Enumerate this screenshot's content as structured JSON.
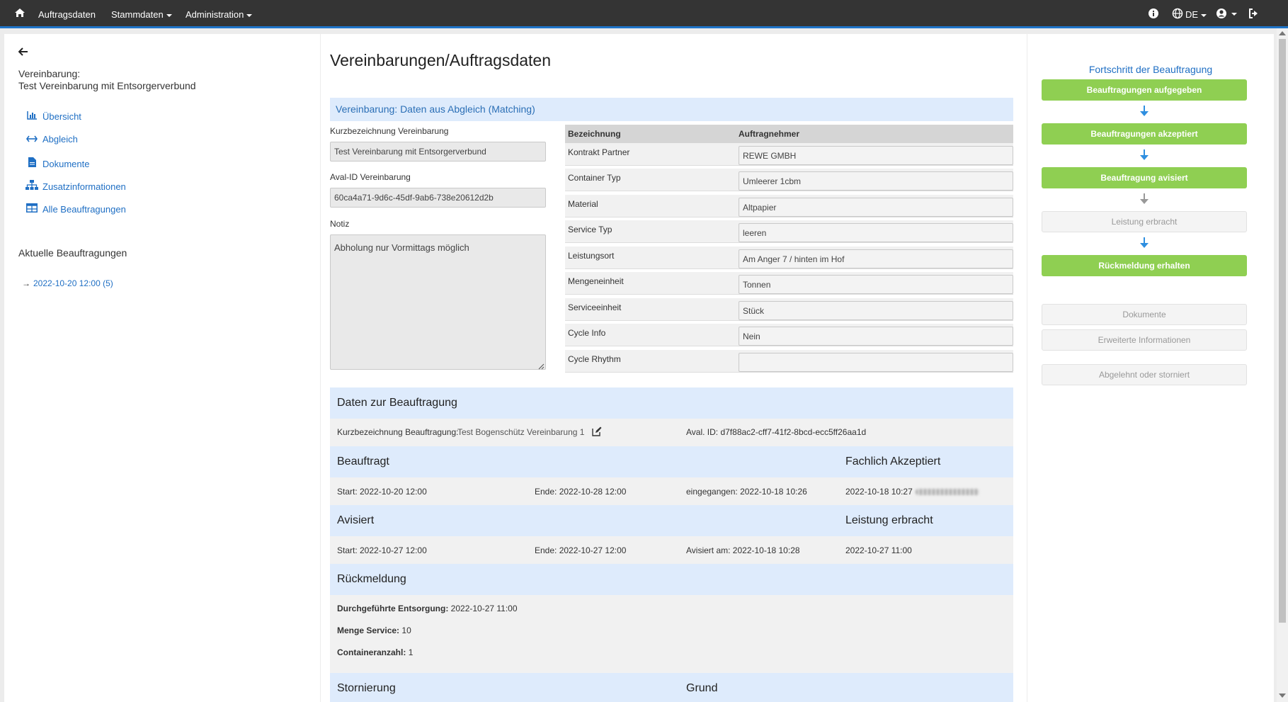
{
  "topbar": {
    "home_icon": "home-icon",
    "nav": [
      "Auftragsdaten",
      "Stammdaten",
      "Administration"
    ],
    "lang": "DE",
    "icons": [
      "info-icon",
      "globe-icon",
      "user-icon",
      "logout-icon"
    ]
  },
  "sidebar": {
    "back_icon": "arrow-left-icon",
    "title_line1": "Vereinbarung:",
    "title_line2": "Test Vereinbarung mit Entsorgerverbund",
    "items": [
      {
        "label": "Übersicht",
        "icon": "chart-icon"
      },
      {
        "label": "Abgleich",
        "icon": "arrows-horizontal-icon"
      },
      {
        "label": "Dokumente",
        "icon": "file-icon"
      },
      {
        "label": "Zusatzinformationen",
        "icon": "sitemap-icon"
      },
      {
        "label": "Alle Beauftragungen",
        "icon": "table-icon"
      }
    ],
    "current_heading": "Aktuelle Beauftragungen",
    "current_item": "2022-10-20 12:00 (5)"
  },
  "main": {
    "title": "Vereinbarungen/Auftragsdaten",
    "matching_band": "Vereinbarung: Daten aus Abgleich (Matching)",
    "kurz_label": "Kurzbezeichnung Vereinbarung",
    "kurz_value": "Test Vereinbarung mit Entsorgerverbund",
    "aval_label": "Aval-ID Vereinbarung",
    "aval_value": "60ca4a71-9d6c-45df-9ab6-738e20612d2b",
    "notiz_label": "Notiz",
    "notiz_value": "Abholung nur Vormittags möglich",
    "table_head": [
      "Bezeichnung",
      "Auftragnehmer"
    ],
    "table_rows": [
      {
        "label": "Kontrakt Partner",
        "value": "REWE GMBH"
      },
      {
        "label": "Container Typ",
        "value": "Umleerer 1cbm"
      },
      {
        "label": "Material",
        "value": "Altpapier"
      },
      {
        "label": "Service Typ",
        "value": "leeren"
      },
      {
        "label": "Leistungsort",
        "value": "Am Anger 7 / hinten im Hof"
      },
      {
        "label": "Mengeneinheit",
        "value": "Tonnen"
      },
      {
        "label": "Serviceeinheit",
        "value": "Stück"
      },
      {
        "label": "Cycle Info",
        "value": "Nein"
      },
      {
        "label": "Cycle Rhythm",
        "value": ""
      }
    ],
    "daten_title": "Daten zur Beauftragung",
    "kurz_b_label": "Kurzbezeichnung Beauftragung:",
    "kurz_b_value": "Test Bogenschütz Vereinbarung 1",
    "edit_icon": "edit-icon",
    "aval_id": "Aval. ID: d7f88ac2-cff7-41f2-8bcd-ecc5ff26aa1d",
    "beauftragt_title": "Beauftragt",
    "fachlich_title": "Fachlich Akzeptiert",
    "b_start": "Start: 2022-10-20 12:00",
    "b_ende": "Ende: 2022-10-28 12:00",
    "b_eingegangen": "eingegangen: 2022-10-18 10:26",
    "b_fachlich": "2022-10-18 10:27",
    "avisiert_title": "Avisiert",
    "leistung_title": "Leistung erbracht",
    "a_start": "Start: 2022-10-27 12:00",
    "a_ende": "Ende: 2022-10-27 12:00",
    "a_avisiert": "Avisiert am: 2022-10-18 10:28",
    "a_leistung": "2022-10-27 11:00",
    "rueck_title": "Rückmeldung",
    "rueck_rows": [
      {
        "label": "Durchgeführte Entsorgung:",
        "value": "2022-10-27 11:00"
      },
      {
        "label": "Menge Service:",
        "value": "10"
      },
      {
        "label": "Containeranzahl:",
        "value": "1"
      }
    ],
    "storno_title": "Stornierung",
    "grund_title": "Grund"
  },
  "progress": {
    "title": "Fortschritt der Beauftragung",
    "steps": [
      {
        "label": "Beauftragungen aufgegeben",
        "done": true
      },
      {
        "label": "Beauftragungen akzeptiert",
        "done": true
      },
      {
        "label": "Beauftragung avisiert",
        "done": true
      },
      {
        "label": "Leistung erbracht",
        "done": false
      },
      {
        "label": "Rückmeldung erhalten",
        "done": true
      }
    ],
    "extra_buttons": [
      "Dokumente",
      "Erweiterte Informationen",
      "Abgelehnt oder storniert"
    ],
    "colors": {
      "done": "#8fcf52",
      "arrow_blue": "#2f8fe0",
      "arrow_gray": "#999999",
      "accent": "#1f74c8"
    }
  }
}
